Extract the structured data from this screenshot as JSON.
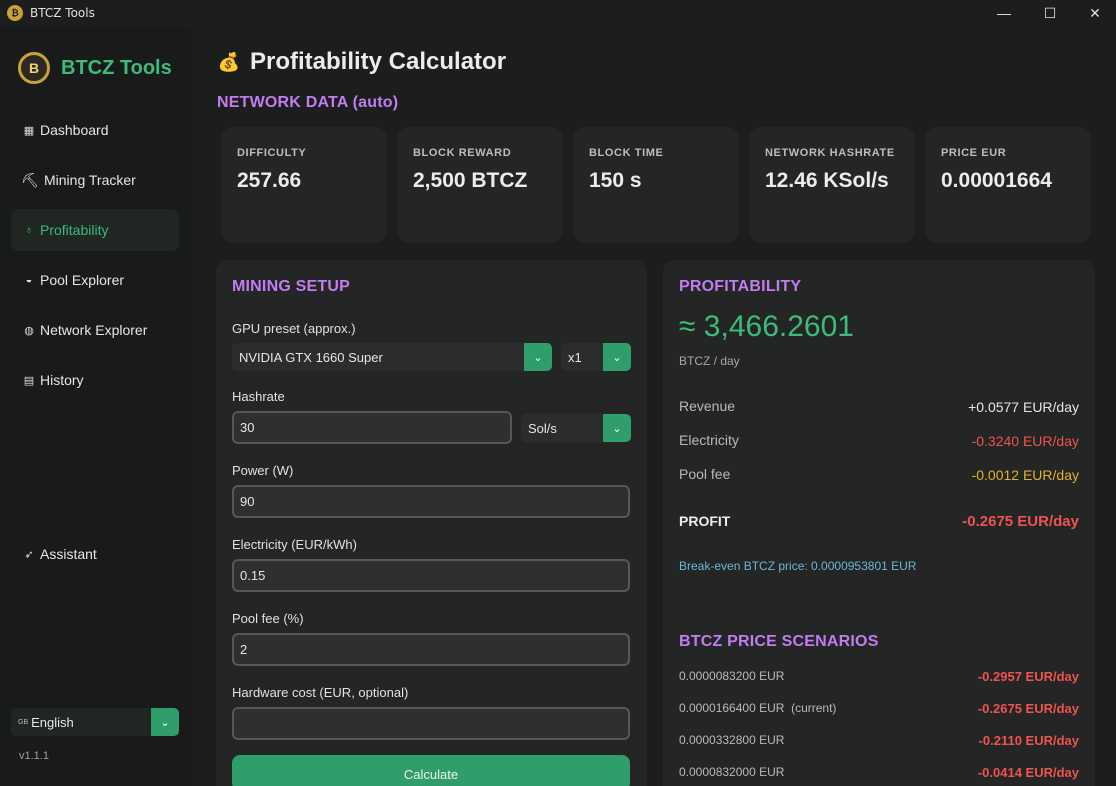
{
  "window": {
    "title": "BTCZ Tools",
    "app_icon_letter": "₿",
    "minimize": "—",
    "maximize": "☐",
    "close": "✕"
  },
  "sidebar": {
    "brand": "BTCZ Tools",
    "brand_logo_letter": "B",
    "items": [
      {
        "label": "Dashboard",
        "icon": "bar-chart-icon",
        "glyph": "▦"
      },
      {
        "label": "Mining Tracker",
        "icon": "pickaxe-icon",
        "glyph": "⛏"
      },
      {
        "label": "Profitability",
        "icon": "money-bag-icon",
        "glyph": "♁"
      },
      {
        "label": "Pool Explorer",
        "icon": "pool-icon",
        "glyph": "◒"
      },
      {
        "label": "Network Explorer",
        "icon": "globe-icon",
        "glyph": "◍"
      },
      {
        "label": "History",
        "icon": "calendar-icon",
        "glyph": "▤"
      },
      {
        "label": "Assistant",
        "icon": "rocket-icon",
        "glyph": "➶"
      }
    ],
    "language": {
      "flag": "GB",
      "value": "English",
      "dropdown": "⌄"
    },
    "version": "v1.1.1"
  },
  "page": {
    "title": "Profitability Calculator",
    "title_icon": "money-bag-icon",
    "title_glyph": "💰"
  },
  "network": {
    "heading": "NETWORK DATA (auto)",
    "cards": [
      {
        "label": "DIFFICULTY",
        "value": "257.66"
      },
      {
        "label": "BLOCK REWARD",
        "value": "2,500 BTCZ"
      },
      {
        "label": "BLOCK TIME",
        "value": "150 s"
      },
      {
        "label": "NETWORK HASHRATE",
        "value": "12.46 KSol/s"
      },
      {
        "label": "PRICE EUR",
        "value": "0.00001664"
      }
    ]
  },
  "setup": {
    "heading": "MINING SETUP",
    "gpu_label": "GPU preset (approx.)",
    "gpu_value": "NVIDIA GTX 1660 Super",
    "gpu_count": "x1",
    "hashrate_label": "Hashrate",
    "hashrate_value": "30",
    "hashrate_unit": "Sol/s",
    "power_label": "Power (W)",
    "power_value": "90",
    "electricity_label": "Electricity (EUR/kWh)",
    "electricity_value": "0.15",
    "poolfee_label": "Pool fee (%)",
    "poolfee_value": "2",
    "hardware_label": "Hardware cost (EUR, optional)",
    "hardware_value": "",
    "calculate": "Calculate"
  },
  "profitability": {
    "heading": "PROFITABILITY",
    "big_value": "≈ 3,466.2601",
    "unit": "BTCZ / day",
    "rows": [
      {
        "label": "Revenue",
        "value": "+0.0577 EUR/day",
        "color": "#e6e6e6"
      },
      {
        "label": "Electricity",
        "value": "-0.3240 EUR/day",
        "color": "#ef5350"
      },
      {
        "label": "Pool fee",
        "value": "-0.0012 EUR/day",
        "color": "#e0b030"
      }
    ],
    "profit_label": "PROFIT",
    "profit_value": "-0.2675 EUR/day",
    "breakeven": "Break-even BTCZ price: 0.0000953801 EUR"
  },
  "scenarios": {
    "heading": "BTCZ PRICE SCENARIOS",
    "rows": [
      {
        "price": "0.0000083200 EUR",
        "value": "-0.2957 EUR/day"
      },
      {
        "price": "0.0000166400 EUR  (current)",
        "value": "-0.2675 EUR/day"
      },
      {
        "price": "0.0000332800 EUR",
        "value": "-0.2110 EUR/day"
      },
      {
        "price": "0.0000832000 EUR",
        "value": "-0.0414 EUR/day"
      }
    ]
  },
  "colors": {
    "accent_green": "#3dbb7a",
    "heading_purple": "#c27cf0",
    "negative_red": "#ef5350",
    "pool_fee_yellow": "#e0b030",
    "link_blue": "#6cb6d8"
  }
}
